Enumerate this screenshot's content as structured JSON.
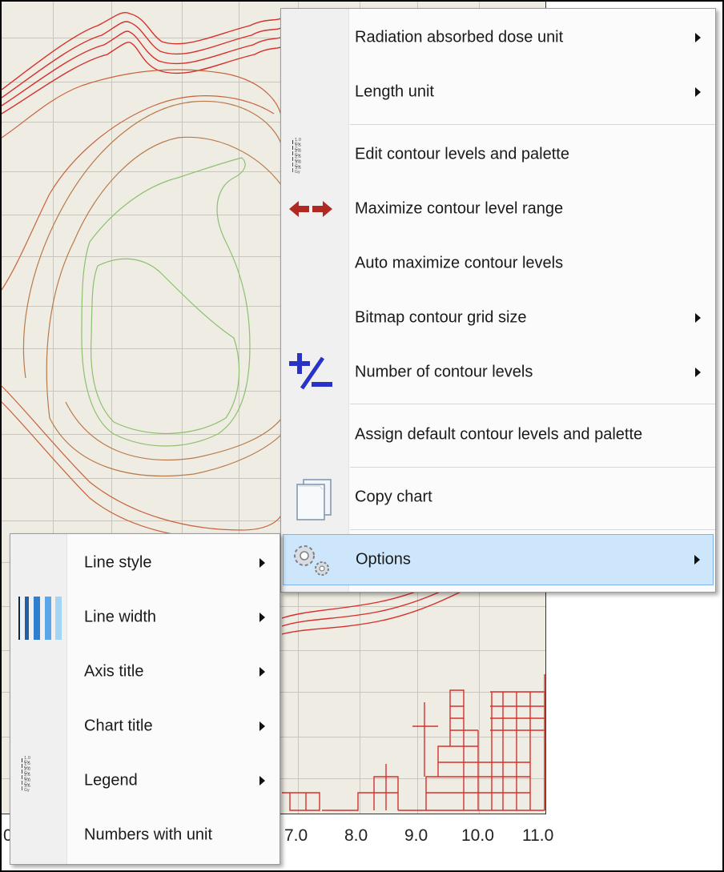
{
  "chart": {
    "x_ticks": [
      "7.0",
      "8.0",
      "9.0",
      "10.0",
      "11.0"
    ],
    "left_tick_fragment": "0"
  },
  "main_menu": {
    "items": [
      {
        "label": "Radiation absorbed dose unit",
        "submenu": true,
        "icon": ""
      },
      {
        "label": "Length unit",
        "submenu": true,
        "icon": ""
      },
      {
        "label": "Edit contour levels and palette",
        "submenu": false,
        "icon": "contour-legend-icon"
      },
      {
        "label": "Maximize contour level range",
        "submenu": false,
        "icon": "double-arrow-icon"
      },
      {
        "label": "Auto maximize contour levels",
        "submenu": false,
        "icon": ""
      },
      {
        "label": "Bitmap contour grid size",
        "submenu": true,
        "icon": ""
      },
      {
        "label": "Number of contour levels",
        "submenu": true,
        "icon": "plus-minus-icon"
      },
      {
        "label": "Assign default contour levels and palette",
        "submenu": false,
        "icon": ""
      },
      {
        "label": "Copy chart",
        "submenu": false,
        "icon": "copy-icon"
      },
      {
        "label": "Options",
        "submenu": true,
        "icon": "gears-icon",
        "highlighted": true
      }
    ]
  },
  "options_submenu": {
    "items": [
      {
        "label": "Line style",
        "submenu": true,
        "icon": ""
      },
      {
        "label": "Line width",
        "submenu": true,
        "icon": "line-width-icon"
      },
      {
        "label": "Axis title",
        "submenu": true,
        "icon": ""
      },
      {
        "label": "Chart title",
        "submenu": true,
        "icon": ""
      },
      {
        "label": "Legend",
        "submenu": true,
        "icon": "contour-legend-icon"
      },
      {
        "label": "Numbers with unit",
        "submenu": false,
        "icon": ""
      }
    ]
  },
  "legend_icon": {
    "levels": [
      "1.0 Gy",
      "1.5 Gy",
      "2.0 Gy",
      "2.5 Gy",
      "3.0 Gy",
      "3.5 Gy"
    ],
    "colors": [
      "#1c1ce0",
      "#3a20c8",
      "#6a1cb0",
      "#961890",
      "#c81860",
      "#f01830"
    ]
  },
  "colors": {
    "highlight_bg": "#cde6fb",
    "highlight_border": "#7eb4ea",
    "chart_bg": "#efece3",
    "contour_red": "#d6302b",
    "contour_orange": "#c8643c",
    "contour_brown": "#b87a4a",
    "contour_green": "#8cc070"
  }
}
